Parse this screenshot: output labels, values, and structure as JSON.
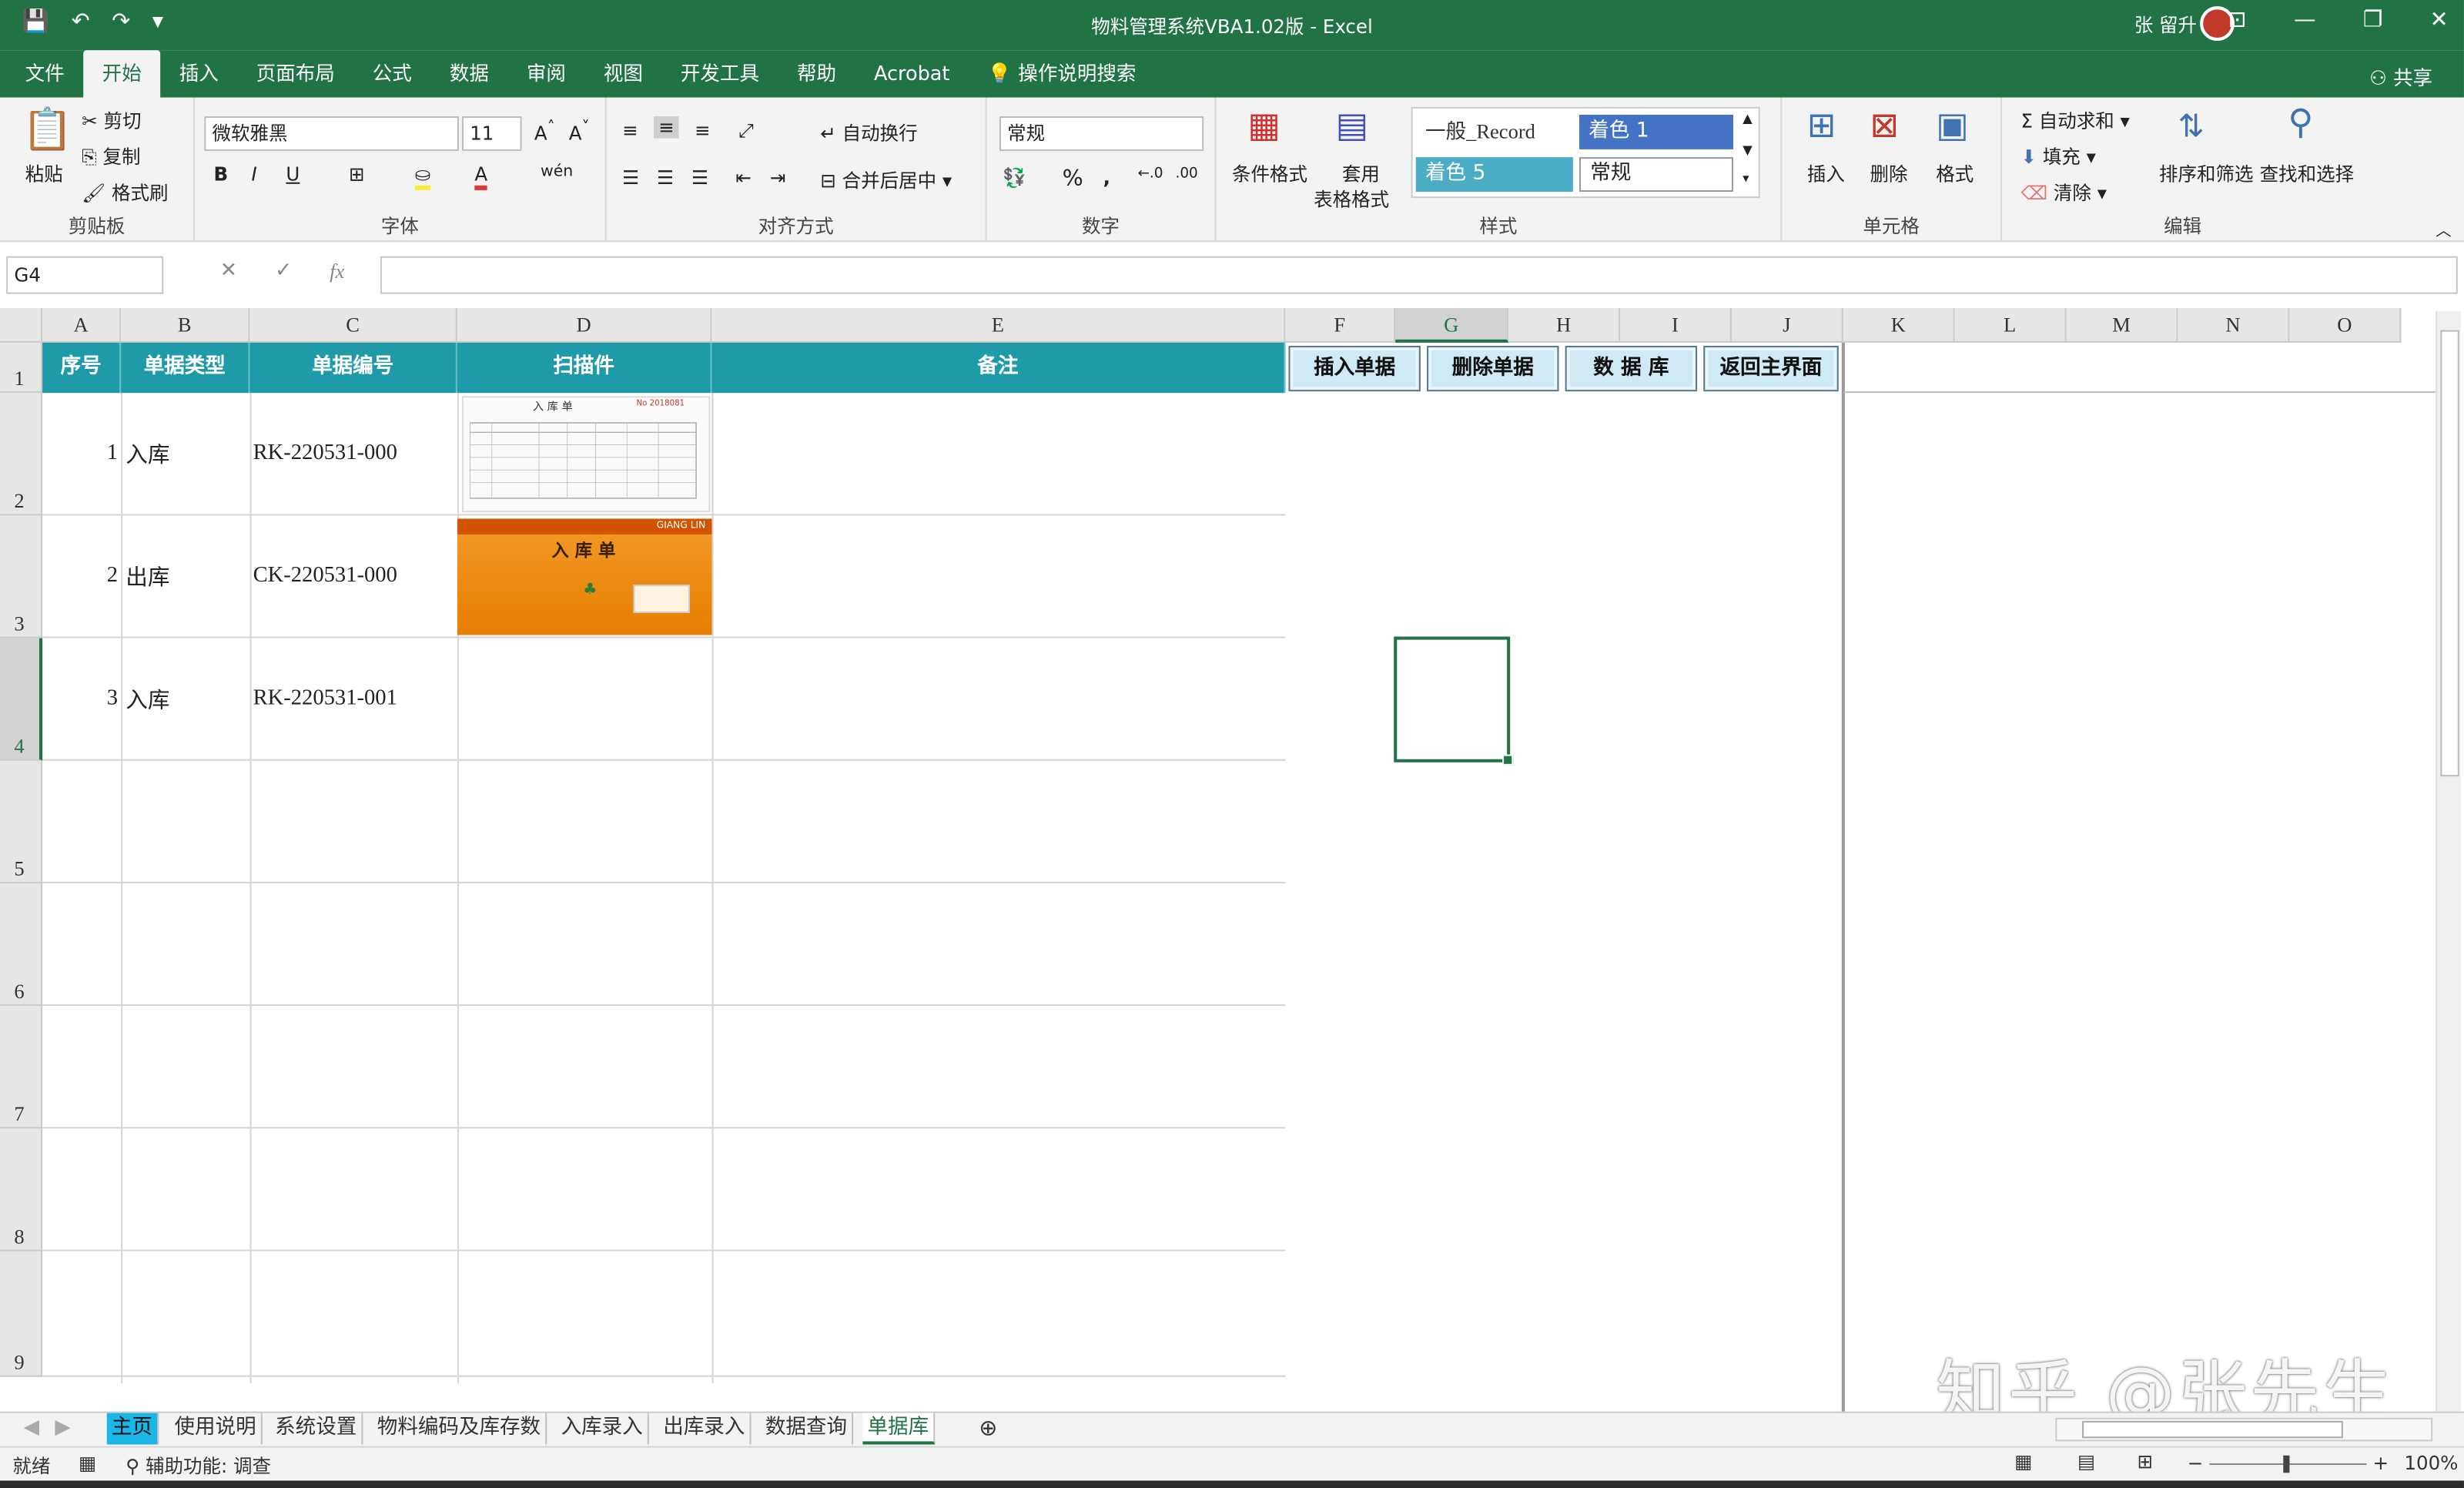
{
  "titlebar": {
    "title": "物料管理系统VBA1.02版  -  Excel",
    "user": "张 留升",
    "share": "共享"
  },
  "menu": {
    "tabs": [
      "文件",
      "开始",
      "插入",
      "页面布局",
      "公式",
      "数据",
      "审阅",
      "视图",
      "开发工具",
      "帮助",
      "Acrobat"
    ],
    "active_index": 1,
    "search": "操作说明搜索"
  },
  "ribbon": {
    "clipboard": {
      "paste": "粘贴",
      "cut": "剪切",
      "copy": "复制",
      "format_painter": "格式刷",
      "label": "剪贴板"
    },
    "font": {
      "name": "微软雅黑",
      "size": "11",
      "label": "字体",
      "bold": "B",
      "italic": "I",
      "underline": "U"
    },
    "alignment": {
      "wrap": "自动换行",
      "merge": "合并后居中",
      "label": "对齐方式"
    },
    "number": {
      "format": "常规",
      "label": "数字"
    },
    "styles": {
      "cond_format": "条件格式",
      "table_format_1": "套用",
      "table_format_2": "表格格式",
      "gallery": [
        "一般_Record",
        "着色 1",
        "着色 5",
        "常规"
      ],
      "label": "样式"
    },
    "cells": {
      "insert": "插入",
      "delete": "删除",
      "format": "格式",
      "label": "单元格"
    },
    "editing": {
      "autosum": "自动求和",
      "fill": "填充",
      "clear": "清除",
      "sort": "排序和筛选",
      "find": "查找和选择",
      "label": "编辑"
    }
  },
  "formula": {
    "namebox": "G4",
    "value": "",
    "fx": "fx"
  },
  "columns": [
    "A",
    "B",
    "C",
    "D",
    "E",
    "F",
    "G",
    "H",
    "I",
    "J",
    "K",
    "L",
    "M",
    "N",
    "O"
  ],
  "selected_column": "G",
  "rows": [
    "1",
    "2",
    "3",
    "4",
    "5",
    "6",
    "7",
    "8",
    "9"
  ],
  "selected_row": "4",
  "table": {
    "headers": [
      "序号",
      "单据类型",
      "单据编号",
      "扫描件",
      "备注"
    ],
    "data": [
      {
        "no": "1",
        "type": "入库",
        "code": "RK-220531-000"
      },
      {
        "no": "2",
        "type": "出库",
        "code": "CK-220531-000"
      },
      {
        "no": "3",
        "type": "入库",
        "code": "RK-220531-001"
      }
    ]
  },
  "buttons": [
    "插入单据",
    "删除单据",
    "数  据  库",
    "返回主界面"
  ],
  "scan1": {
    "title": "入 库 单",
    "no": "No 2018081"
  },
  "scan2": {
    "title": "入 库 单",
    "brand": "GIANG LIN"
  },
  "sheets": [
    "主页",
    "使用说明",
    "系统设置",
    "物料编码及库存数",
    "入库录入",
    "出库录入",
    "数据查询",
    "单据库"
  ],
  "active_sheet": "单据库",
  "status": {
    "ready": "就绪",
    "accessibility": "辅助功能: 调查",
    "zoom": "100%"
  },
  "watermark": "知乎 @张先生",
  "colors": {
    "excel_green": "#217346",
    "header_teal": "#1f9aa8",
    "button_bg": "#cfe9f5"
  }
}
